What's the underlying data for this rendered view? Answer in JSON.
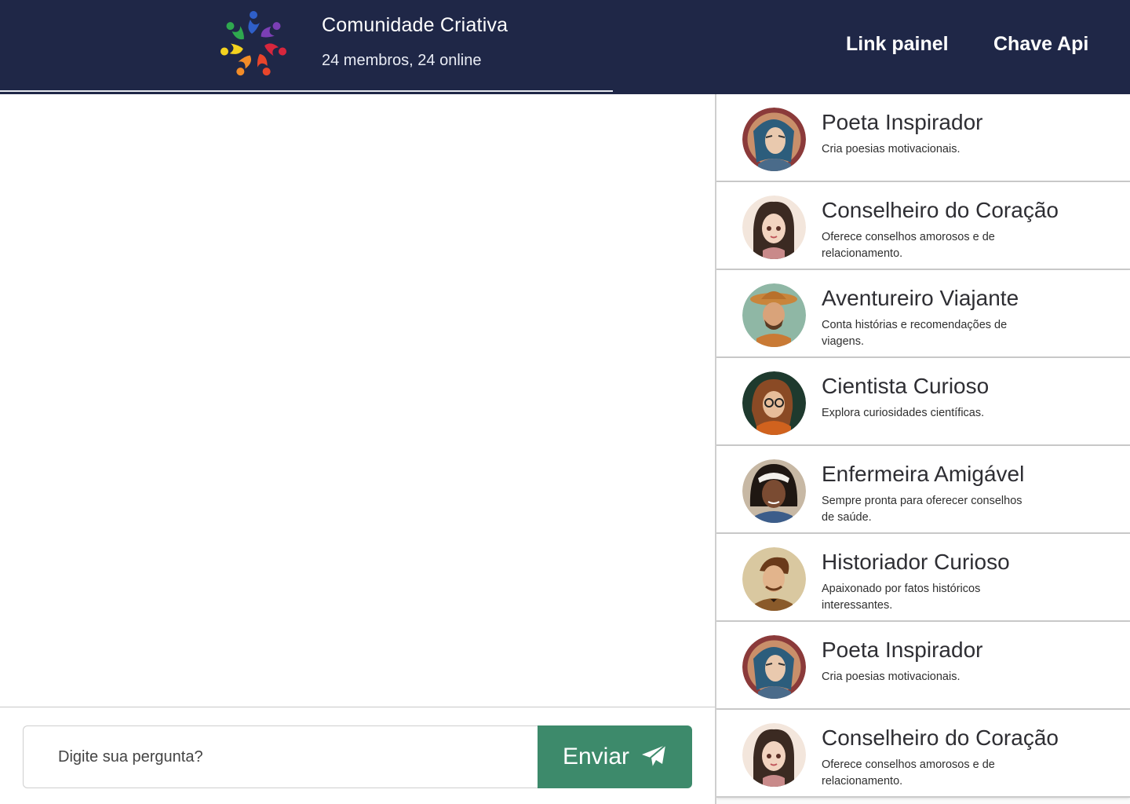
{
  "header": {
    "title": "Comunidade Criativa",
    "subtitle": "24 membros, 24 online",
    "nav": [
      {
        "label": "Link painel"
      },
      {
        "label": "Chave Api"
      }
    ],
    "logo_icon": "community-people-circle-logo"
  },
  "composer": {
    "placeholder": "Digite sua pergunta?",
    "send_label": "Enviar",
    "send_icon": "paper-plane-icon"
  },
  "members": [
    {
      "name": "Poeta Inspirador",
      "description": "Cria poesias motivacionais.",
      "avatar": "poet-avatar"
    },
    {
      "name": "Conselheiro do Coração",
      "description": "Oferece conselhos amorosos e de relacionamento.",
      "avatar": "heart-advisor-avatar"
    },
    {
      "name": "Aventureiro Viajante",
      "description": "Conta histórias e recomendações de viagens.",
      "avatar": "traveler-avatar"
    },
    {
      "name": "Cientista Curioso",
      "description": "Explora curiosidades científicas.",
      "avatar": "scientist-avatar"
    },
    {
      "name": "Enfermeira Amigável",
      "description": "Sempre pronta para oferecer conselhos de saúde.",
      "avatar": "nurse-avatar"
    },
    {
      "name": "Historiador Curioso",
      "description": "Apaixonado por fatos históricos interessantes.",
      "avatar": "historian-avatar"
    },
    {
      "name": "Poeta Inspirador",
      "description": "Cria poesias motivacionais.",
      "avatar": "poet-avatar"
    },
    {
      "name": "Conselheiro do Coração",
      "description": "Oferece conselhos amorosos e de relacionamento.",
      "avatar": "heart-advisor-avatar"
    }
  ],
  "colors": {
    "header_bg": "#1f2747",
    "send_bg": "#3d8a6b"
  }
}
